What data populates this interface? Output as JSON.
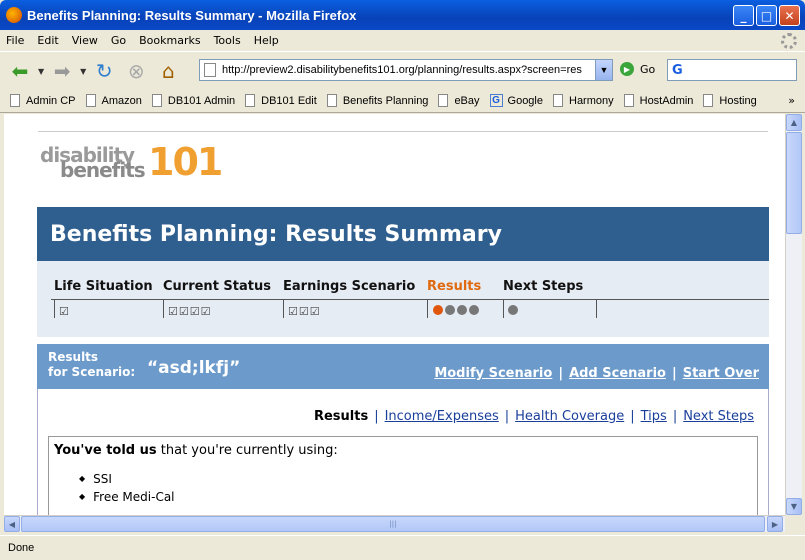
{
  "window": {
    "title": "Benefits Planning: Results Summary - Mozilla Firefox"
  },
  "menu": [
    "File",
    "Edit",
    "View",
    "Go",
    "Bookmarks",
    "Tools",
    "Help"
  ],
  "nav": {
    "url": "http://preview2.disabilitybenefits101.org/planning/results.aspx?screen=res",
    "go_label": "Go"
  },
  "bookmarks": [
    "Admin CP",
    "Amazon",
    "DB101 Admin",
    "DB101 Edit",
    "Benefits Planning",
    "eBay",
    "Google",
    "Harmony",
    "HostAdmin",
    "Hosting"
  ],
  "status": "Done",
  "page": {
    "logo": {
      "line1": "disability",
      "line2": "benefits",
      "number": "101"
    },
    "title": "Benefits Planning: Results Summary",
    "steps": [
      "Life Situation",
      "Current Status",
      "Earnings Scenario",
      "Results",
      "Next Steps"
    ],
    "results_label_1": "Results",
    "results_label_2": "for Scenario:",
    "scenario_name": "“asd;lkfj”",
    "actions": [
      "Modify Scenario",
      "Add Scenario",
      "Start Over"
    ],
    "tabs": {
      "current": "Results",
      "links": [
        "Income/Expenses",
        "Health Coverage",
        "Tips",
        "Next Steps"
      ]
    },
    "told_bold": "You've told us",
    "told_rest": " that you're currently using:",
    "using": [
      "SSI",
      "Free Medi-Cal"
    ]
  }
}
